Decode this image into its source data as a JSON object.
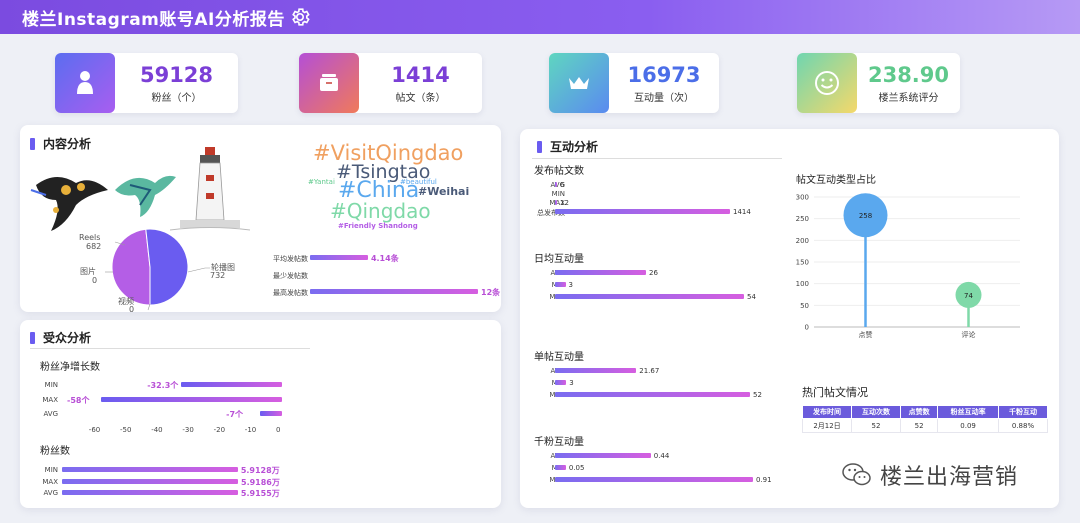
{
  "header": {
    "title": "楼兰Instagram账号AI分析报告"
  },
  "kpis": [
    {
      "value": "59128",
      "label": "粉丝（个）",
      "color": "#7b3fd6"
    },
    {
      "value": "1414",
      "label": "帖文（条）",
      "color": "#7b3fd6"
    },
    {
      "value": "16973",
      "label": "互动量（次）",
      "color": "#4b6ee8"
    },
    {
      "value": "238.90",
      "label": "楼兰系统评分",
      "color": "#5fc98c"
    }
  ],
  "content": {
    "title": "内容分析",
    "pie": {
      "slices": [
        {
          "name": "Reels",
          "value": "682"
        },
        {
          "name": "图片",
          "value": "0"
        },
        {
          "name": "视频",
          "value": "0"
        },
        {
          "name": "轮播图",
          "value": "732"
        }
      ],
      "colors": [
        "#b45ee6",
        "#6a5cf0"
      ]
    },
    "wordcloud": [
      "#VisitQingdao",
      "#Tsingtao",
      "#China",
      "#Weihai",
      "#Qingdao",
      "#Yantai",
      "#beautiful",
      "#Friendly Shandong"
    ],
    "bars": [
      {
        "label": "平均发帖数",
        "value": "4.14条",
        "num": 4.14
      },
      {
        "label": "最少发帖数",
        "value": "",
        "num": 0
      },
      {
        "label": "最高发帖数",
        "value": "12条",
        "num": 12
      }
    ]
  },
  "audience": {
    "title": "受众分析",
    "growth": {
      "title": "粉丝净增长数",
      "rows": [
        {
          "label": "MIN",
          "value": "-32.3个",
          "num": -32.3
        },
        {
          "label": "MAX",
          "value": "-58个",
          "num": -58
        },
        {
          "label": "AVG",
          "value": "-7个",
          "num": -7
        }
      ],
      "ticks": [
        "-60",
        "-50",
        "-40",
        "-30",
        "-20",
        "-10",
        "0"
      ]
    },
    "followers": {
      "title": "粉丝数",
      "rows": [
        {
          "label": "MIN",
          "value": "5.9128万",
          "num": 5.9128
        },
        {
          "label": "MAX",
          "value": "5.9186万",
          "num": 5.9186
        },
        {
          "label": "AVG",
          "value": "5.9155万",
          "num": 5.9155
        }
      ]
    }
  },
  "interaction": {
    "title": "互动分析",
    "groups": [
      {
        "title": "发布帖文数",
        "max": 1414,
        "rows": [
          {
            "label": "AVG",
            "value": "6",
            "num": 6
          },
          {
            "label": "MIN",
            "value": "",
            "num": 0
          },
          {
            "label": "MAX",
            "value": "12",
            "num": 12
          },
          {
            "label": "总发布数",
            "value": "1414",
            "num": 1414
          }
        ]
      },
      {
        "title": "日均互动量",
        "max": 54,
        "rows": [
          {
            "label": "AVG",
            "value": "26",
            "num": 26
          },
          {
            "label": "MIN",
            "value": "3",
            "num": 3
          },
          {
            "label": "MAX",
            "value": "54",
            "num": 54
          }
        ]
      },
      {
        "title": "单帖互动量",
        "max": 52,
        "rows": [
          {
            "label": "AVG",
            "value": "21.67",
            "num": 21.67
          },
          {
            "label": "MIN",
            "value": "3",
            "num": 3
          },
          {
            "label": "MAX",
            "value": "52",
            "num": 52
          }
        ]
      },
      {
        "title": "千粉互动量",
        "max": 0.91,
        "rows": [
          {
            "label": "AVG",
            "value": "0.44",
            "num": 0.44
          },
          {
            "label": "MIN",
            "value": "0.05",
            "num": 0.05
          },
          {
            "label": "MAX",
            "value": "0.91",
            "num": 0.91
          }
        ]
      }
    ],
    "lollipop_title": "帖文互动类型占比",
    "hot_title": "热门帖文情况",
    "table": {
      "headers": [
        "发布时间",
        "互动次数",
        "点赞数",
        "粉丝互动率",
        "千粉互动"
      ],
      "rows": [
        [
          "2月12日",
          "52",
          "52",
          "0.09",
          "0.88%"
        ]
      ]
    }
  },
  "watermark": "楼兰出海营销",
  "chart_data": [
    {
      "type": "pie",
      "categories": [
        "Reels",
        "图片",
        "视频",
        "轮播图"
      ],
      "values": [
        682,
        0,
        0,
        732
      ]
    },
    {
      "type": "scatter",
      "title": "帖文互动类型占比",
      "categories": [
        "点赞",
        "评论"
      ],
      "values": [
        258,
        74
      ],
      "y_ticks": [
        "0",
        "50",
        "100",
        "150",
        "200",
        "250",
        "300"
      ],
      "ylim": [
        0,
        300
      ],
      "colors": [
        "#5aa8ee",
        "#7fd9a8"
      ]
    }
  ]
}
